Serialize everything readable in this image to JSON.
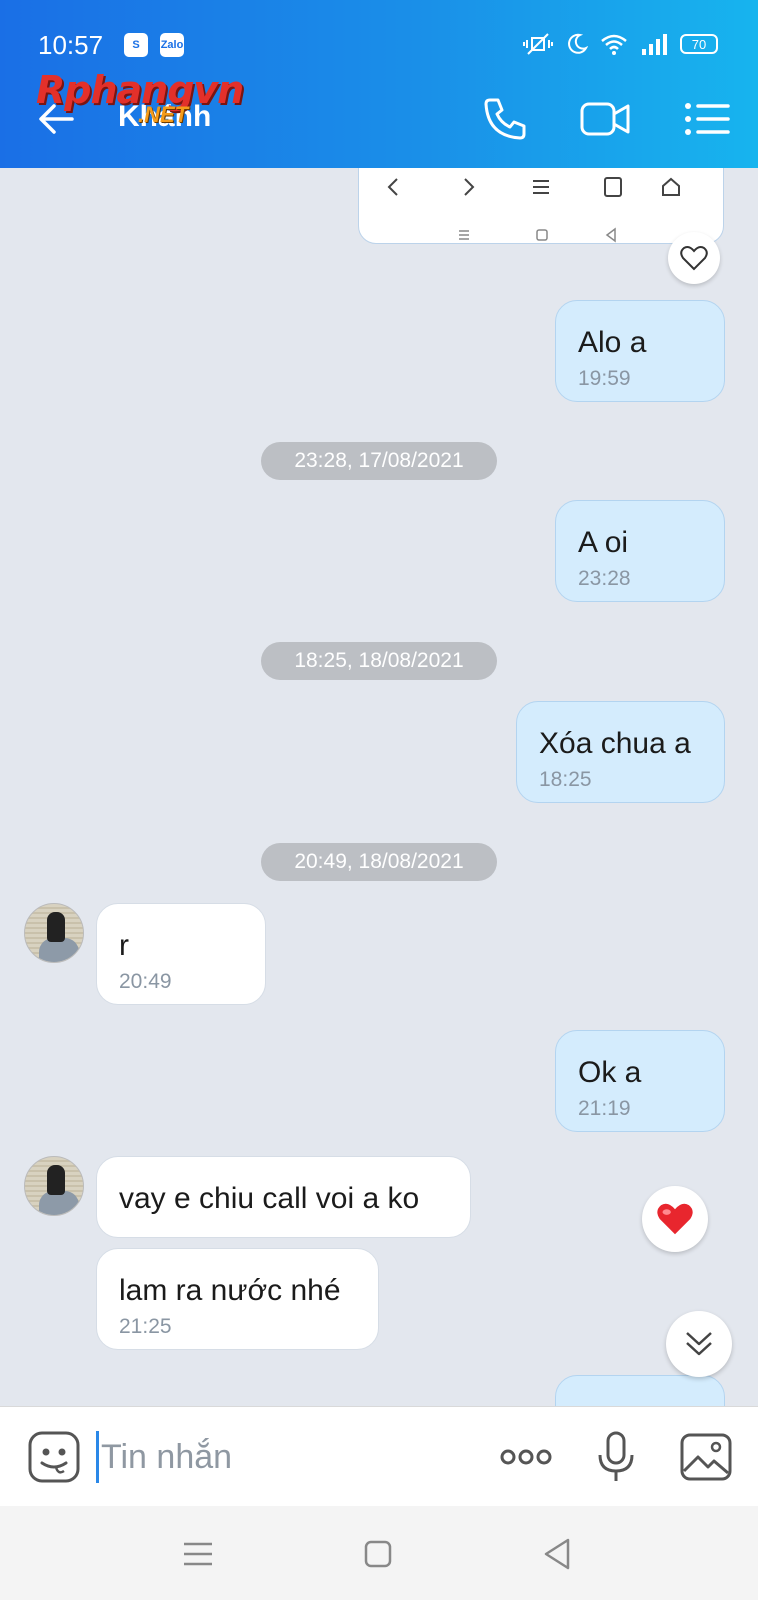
{
  "status_bar": {
    "time": "10:57",
    "app_icons": [
      "S",
      "Zalo"
    ],
    "battery": "70"
  },
  "header": {
    "title": "Khánh",
    "watermark_main": "Rphangvn",
    "watermark_sub": ".NET"
  },
  "messages": [
    {
      "direction": "out",
      "text": "Alo a",
      "time": "19:59"
    },
    {
      "date": "23:28, 17/08/2021"
    },
    {
      "direction": "out",
      "text": "A oi",
      "time": "23:28"
    },
    {
      "date": "18:25, 18/08/2021"
    },
    {
      "direction": "out",
      "text": "Xóa chua a",
      "time": "18:25"
    },
    {
      "date": "20:49, 18/08/2021"
    },
    {
      "direction": "in",
      "text": "r",
      "time": "20:49"
    },
    {
      "direction": "out",
      "text": "Ok a",
      "time": "21:19"
    },
    {
      "direction": "in",
      "text": "vay e chiu call voi a ko"
    },
    {
      "direction": "in",
      "text": "lam ra nước nhé",
      "time": "21:25"
    }
  ],
  "input": {
    "placeholder": "Tin nhắn"
  },
  "colors": {
    "header_gradient_start": "#1a6fe6",
    "header_gradient_end": "#17b4ee",
    "outgoing_bubble": "#d4ecfd",
    "incoming_bubble": "#ffffff",
    "chat_background": "#e3e7ee",
    "heart_red": "#e8262e"
  }
}
